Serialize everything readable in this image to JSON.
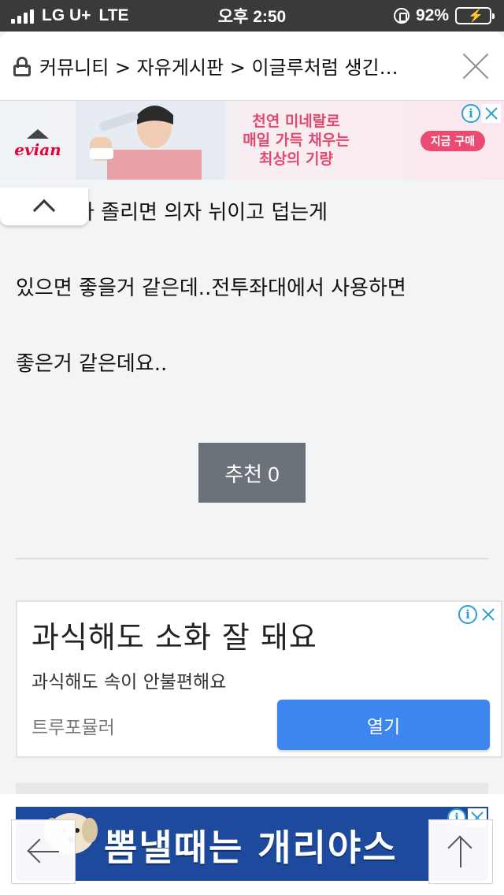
{
  "status_bar": {
    "carrier": "LG U+",
    "network": "LTE",
    "time": "오후 2:50",
    "battery": "92%"
  },
  "header": {
    "breadcrumb": "커뮤니티 > 자유게시판 > 이글루처럼 생긴…"
  },
  "ad_top": {
    "brand": "evian",
    "slogan_line1": "천연 미네랄로",
    "slogan_line2": "매일 가득 채우는",
    "slogan_line3": "최상의 기량",
    "cta": "지금 구매"
  },
  "article": {
    "paragraphs": [
      "다 졸리면 의자 뉘이고 덥는게",
      "있으면 좋을거 같은데..전투좌대에서 사용하면",
      "좋은거 같은데요.."
    ],
    "recommend_label": "추천 0"
  },
  "native_ad": {
    "headline": "과식해도 소화 잘 돼요",
    "description": "과식해도 속이 안불편해요",
    "advertiser": "트루포뮬러",
    "cta": "열기"
  },
  "ad_bottom": {
    "slogan": "뽐낼때는 개리야스"
  },
  "colors": {
    "accent_blue": "#3d86f0",
    "recommend_gray": "#6c727a",
    "evian_pink": "#e3486e"
  }
}
